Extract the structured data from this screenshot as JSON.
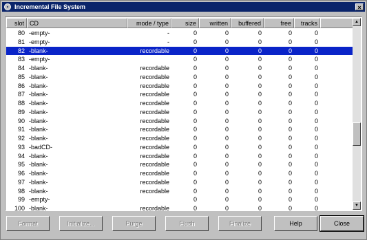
{
  "window": {
    "title": "Incremental File System",
    "close_glyph": "×"
  },
  "columns": [
    {
      "label": "slot"
    },
    {
      "label": "CD"
    },
    {
      "label": "mode / type"
    },
    {
      "label": "size"
    },
    {
      "label": "written"
    },
    {
      "label": "buffered"
    },
    {
      "label": "free"
    },
    {
      "label": "tracks"
    }
  ],
  "rows": [
    {
      "slot": "80",
      "cd": "-empty-",
      "mode": "-",
      "size": "0",
      "written": "0",
      "buffered": "0",
      "free": "0",
      "tracks": "0"
    },
    {
      "slot": "81",
      "cd": "-empty-",
      "mode": "-",
      "size": "0",
      "written": "0",
      "buffered": "0",
      "free": "0",
      "tracks": "0"
    },
    {
      "slot": "82",
      "cd": "-blank-",
      "mode": "recordable",
      "size": "0",
      "written": "0",
      "buffered": "0",
      "free": "0",
      "tracks": "0",
      "selected": true
    },
    {
      "slot": "83",
      "cd": "-empty-",
      "mode": "",
      "size": "0",
      "written": "0",
      "buffered": "0",
      "free": "0",
      "tracks": "0"
    },
    {
      "slot": "84",
      "cd": "-blank-",
      "mode": "recordable",
      "size": "0",
      "written": "0",
      "buffered": "0",
      "free": "0",
      "tracks": "0"
    },
    {
      "slot": "85",
      "cd": "-blank-",
      "mode": "recordable",
      "size": "0",
      "written": "0",
      "buffered": "0",
      "free": "0",
      "tracks": "0"
    },
    {
      "slot": "86",
      "cd": "-blank-",
      "mode": "recordable",
      "size": "0",
      "written": "0",
      "buffered": "0",
      "free": "0",
      "tracks": "0"
    },
    {
      "slot": "87",
      "cd": "-blank-",
      "mode": "recordable",
      "size": "0",
      "written": "0",
      "buffered": "0",
      "free": "0",
      "tracks": "0"
    },
    {
      "slot": "88",
      "cd": "-blank-",
      "mode": "recordable",
      "size": "0",
      "written": "0",
      "buffered": "0",
      "free": "0",
      "tracks": "0"
    },
    {
      "slot": "89",
      "cd": "-blank-",
      "mode": "recordable",
      "size": "0",
      "written": "0",
      "buffered": "0",
      "free": "0",
      "tracks": "0"
    },
    {
      "slot": "90",
      "cd": "-blank-",
      "mode": "recordable",
      "size": "0",
      "written": "0",
      "buffered": "0",
      "free": "0",
      "tracks": "0"
    },
    {
      "slot": "91",
      "cd": "-blank-",
      "mode": "recordable",
      "size": "0",
      "written": "0",
      "buffered": "0",
      "free": "0",
      "tracks": "0"
    },
    {
      "slot": "92",
      "cd": "-blank-",
      "mode": "recordable",
      "size": "0",
      "written": "0",
      "buffered": "0",
      "free": "0",
      "tracks": "0"
    },
    {
      "slot": "93",
      "cd": "-badCD-",
      "mode": "recordable",
      "size": "0",
      "written": "0",
      "buffered": "0",
      "free": "0",
      "tracks": "0"
    },
    {
      "slot": "94",
      "cd": "-blank-",
      "mode": "recordable",
      "size": "0",
      "written": "0",
      "buffered": "0",
      "free": "0",
      "tracks": "0"
    },
    {
      "slot": "95",
      "cd": "-blank-",
      "mode": "recordable",
      "size": "0",
      "written": "0",
      "buffered": "0",
      "free": "0",
      "tracks": "0"
    },
    {
      "slot": "96",
      "cd": "-blank-",
      "mode": "recordable",
      "size": "0",
      "written": "0",
      "buffered": "0",
      "free": "0",
      "tracks": "0"
    },
    {
      "slot": "97",
      "cd": "-blank-",
      "mode": "recordable",
      "size": "0",
      "written": "0",
      "buffered": "0",
      "free": "0",
      "tracks": "0"
    },
    {
      "slot": "98",
      "cd": "-blank-",
      "mode": "recordable",
      "size": "0",
      "written": "0",
      "buffered": "0",
      "free": "0",
      "tracks": "0"
    },
    {
      "slot": "99",
      "cd": "-empty-",
      "mode": "",
      "size": "0",
      "written": "0",
      "buffered": "0",
      "free": "0",
      "tracks": "0"
    },
    {
      "slot": "100",
      "cd": "-blank-",
      "mode": "recordable",
      "size": "0",
      "written": "0",
      "buffered": "0",
      "free": "0",
      "tracks": "0"
    }
  ],
  "scrollbar": {
    "up_glyph": "▲",
    "down_glyph": "▼"
  },
  "buttons": {
    "format": "Format",
    "initialize": "Initialize...",
    "purge": "Purge",
    "flush": "Flush",
    "finalize": "Finalize",
    "help": "Help",
    "close": "Close"
  },
  "colors": {
    "selection": "#0a24c8",
    "titlebar": "#0a246a",
    "face": "#c0c0c0"
  }
}
